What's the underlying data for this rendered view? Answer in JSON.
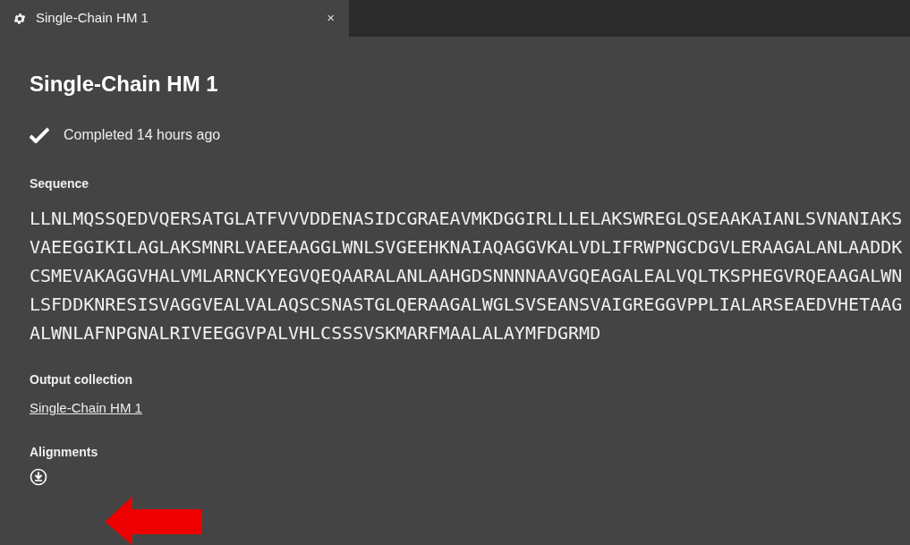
{
  "tab": {
    "title": "Single-Chain HM 1",
    "close": "×",
    "selected": true
  },
  "title": "Single-Chain HM 1",
  "status": {
    "completed": true,
    "text": "Completed 14 hours ago"
  },
  "sequence": {
    "label": "Sequence",
    "lines": [
      "LLNLMQSSQEDVQERSATGLATFVVVDDENASIDCGRAEAVMKDGGIRLLLELAKSWREGLQSEAAKAIANLSVNANIAKS",
      "VAEEGGIKILAGLAKSMNRLVAEEAAGGLWNLSVGEEHKNAIAQAGGVKALVDLIFRWPNGCDGVLERAAGALANLAADDK",
      "CSMEVAKAGGVHALVMLARNCKYEGVQEQAARALANLAAHGDSNNNNAAVGQEAGALEALVQLTKSPHEGVRQEAAGALWN",
      "LSFDDKNRESISVAGGVEALVALAQSCSNASTGLQERAAGALWGLSVSEANSVAIGREGGVPPLIALARSEAEDVHETAAG",
      "ALWNLAFNPGNALRIVEEGGVPALVHLCSSSVSKMARFMAALALAYMFDGRMD"
    ]
  },
  "output_collection": {
    "label": "Output collection",
    "link": "Single-Chain HM 1"
  },
  "alignments": {
    "label": "Alignments"
  }
}
